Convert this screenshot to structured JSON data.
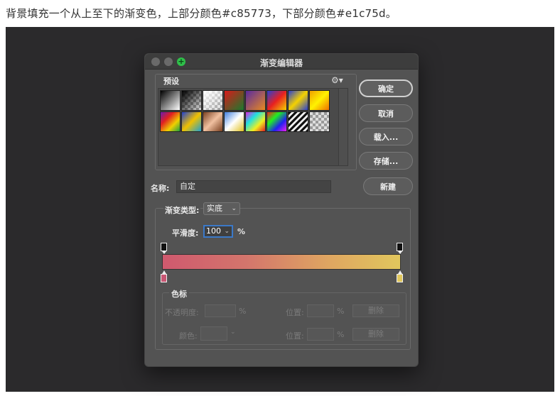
{
  "caption": "背景填充一个从上至下的渐变色，上部分颜色#c85773，下部分颜色#e1c75d。",
  "dialog": {
    "title": "渐变编辑器",
    "presets_label": "预设",
    "gear_icon": "gear-icon",
    "buttons": {
      "ok": "确定",
      "cancel": "取消",
      "load": "载入...",
      "save": "存储...",
      "new": "新建"
    },
    "name_label": "名称:",
    "name_value": "自定",
    "gradient_type_label": "渐变类型:",
    "gradient_type_value": "实底",
    "smoothness_label": "平滑度:",
    "smoothness_value": "100",
    "percent": "%",
    "color_stops": {
      "group_label": "色标",
      "opacity_label": "不透明度:",
      "location_label": "位置:",
      "delete_label": "删除",
      "color_label": "颜色:"
    },
    "stop_colors": {
      "left": "#c85773",
      "right": "#e1c75d"
    }
  }
}
